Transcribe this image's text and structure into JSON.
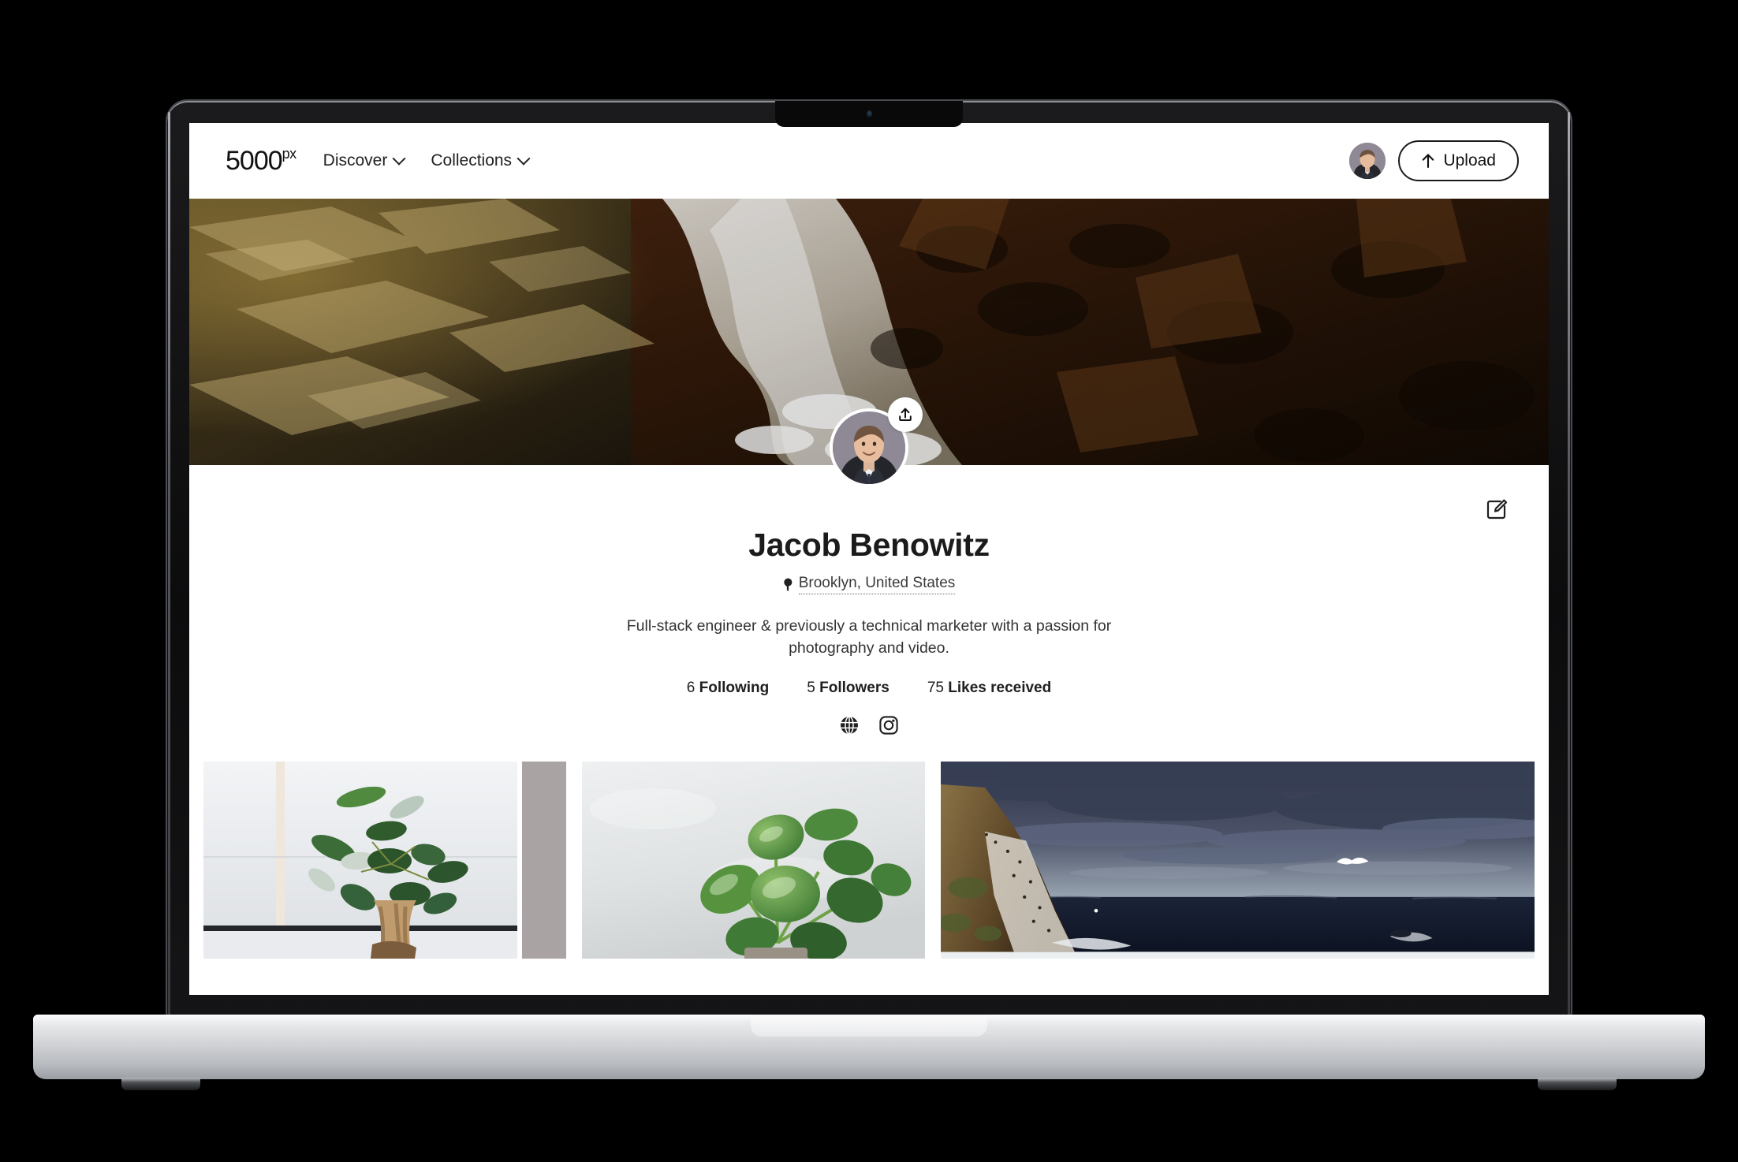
{
  "header": {
    "logo_main": "5000",
    "logo_suffix": "px",
    "nav": [
      {
        "label": "Discover",
        "icon": "chevron-down-icon"
      },
      {
        "label": "Collections",
        "icon": "chevron-down-icon"
      }
    ],
    "upload_label": "Upload",
    "upload_icon": "arrow-up-icon",
    "avatar_icon": "user-avatar"
  },
  "cover": {
    "alt": "Aerial photo of ocean waves breaking over dark rocks",
    "upload_badge_icon": "upload-icon"
  },
  "profile": {
    "edit_icon": "edit-pencil-square-icon",
    "name": "Jacob Benowitz",
    "location": "Brooklyn, United States",
    "location_icon": "map-pin-icon",
    "bio": "Full-stack engineer & previously a technical marketer with a passion for photography and video.",
    "stats": [
      {
        "value": "6",
        "label": "Following"
      },
      {
        "value": "5",
        "label": "Followers"
      },
      {
        "value": "75",
        "label": "Likes received"
      }
    ],
    "socials": [
      {
        "name": "website-globe-icon"
      },
      {
        "name": "instagram-icon"
      }
    ]
  },
  "gallery": {
    "items": [
      {
        "alt": "Ficus ginseng bonsai plant on a bright windowsill"
      },
      {
        "alt": "Peperomia houseplant with glossy round leaves against a grey wall"
      },
      {
        "alt": "Coastal cliff with seabirds above a dark ocean under stormy clouds"
      }
    ]
  },
  "colors": {
    "accent": "#111111",
    "page_background": "#000000",
    "surface": "#ffffff"
  }
}
